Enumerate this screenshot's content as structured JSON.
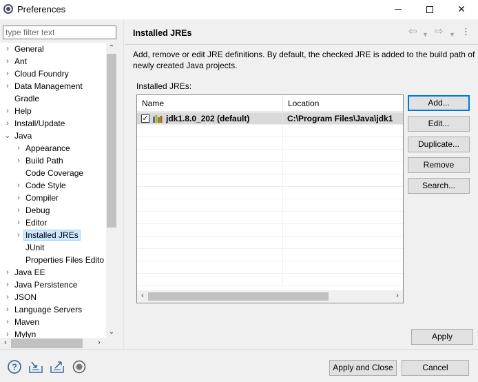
{
  "window": {
    "title": "Preferences",
    "minimize": "minimize",
    "maximize": "maximize",
    "close": "✕"
  },
  "filter": {
    "placeholder": "type filter text",
    "value": ""
  },
  "tree": {
    "items": [
      {
        "label": "General",
        "level": 0,
        "expander": "collapsed"
      },
      {
        "label": "Ant",
        "level": 0,
        "expander": "collapsed"
      },
      {
        "label": "Cloud Foundry",
        "level": 0,
        "expander": "collapsed"
      },
      {
        "label": "Data Management",
        "level": 0,
        "expander": "collapsed"
      },
      {
        "label": "Gradle",
        "level": 0,
        "expander": "none"
      },
      {
        "label": "Help",
        "level": 0,
        "expander": "collapsed"
      },
      {
        "label": "Install/Update",
        "level": 0,
        "expander": "collapsed"
      },
      {
        "label": "Java",
        "level": 0,
        "expander": "expanded"
      },
      {
        "label": "Appearance",
        "level": 1,
        "expander": "collapsed"
      },
      {
        "label": "Build Path",
        "level": 1,
        "expander": "collapsed"
      },
      {
        "label": "Code Coverage",
        "level": 1,
        "expander": "none"
      },
      {
        "label": "Code Style",
        "level": 1,
        "expander": "collapsed"
      },
      {
        "label": "Compiler",
        "level": 1,
        "expander": "collapsed"
      },
      {
        "label": "Debug",
        "level": 1,
        "expander": "collapsed"
      },
      {
        "label": "Editor",
        "level": 1,
        "expander": "collapsed"
      },
      {
        "label": "Installed JREs",
        "level": 1,
        "expander": "collapsed",
        "selected": true
      },
      {
        "label": "JUnit",
        "level": 1,
        "expander": "none"
      },
      {
        "label": "Properties Files Edito",
        "level": 1,
        "expander": "none"
      },
      {
        "label": "Java EE",
        "level": 0,
        "expander": "collapsed"
      },
      {
        "label": "Java Persistence",
        "level": 0,
        "expander": "collapsed"
      },
      {
        "label": "JSON",
        "level": 0,
        "expander": "collapsed"
      },
      {
        "label": "Language Servers",
        "level": 0,
        "expander": "collapsed"
      },
      {
        "label": "Maven",
        "level": 0,
        "expander": "collapsed"
      },
      {
        "label": "Mylyn",
        "level": 0,
        "expander": "collapsed"
      }
    ]
  },
  "page": {
    "title": "Installed JREs",
    "description": "Add, remove or edit JRE definitions. By default, the checked JRE is added to the build path of newly created Java projects.",
    "installed_label": "Installed JREs:",
    "columns": {
      "name": "Name",
      "location": "Location"
    },
    "rows": [
      {
        "checked": true,
        "name": "jdk1.8.0_202 (default)",
        "location": "C:\\Program Files\\Java\\jdk1"
      }
    ],
    "empty_rows": 13,
    "buttons": {
      "add": "Add...",
      "edit": "Edit...",
      "duplicate": "Duplicate...",
      "remove": "Remove",
      "search": "Search..."
    },
    "apply": "Apply"
  },
  "footer": {
    "apply_and_close": "Apply and Close",
    "cancel": "Cancel",
    "icons": [
      "help-icon",
      "import-icon",
      "export-icon",
      "record-icon"
    ]
  },
  "colors": {
    "selection": "#cce8ff",
    "default_button_border": "#0078d7",
    "row_selected": "#d9d9d9"
  }
}
